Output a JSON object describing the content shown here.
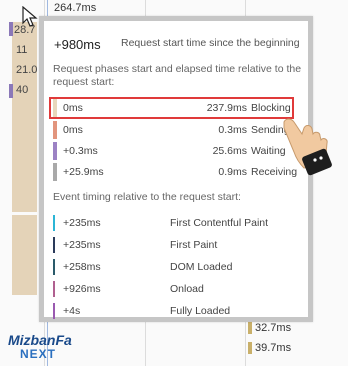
{
  "background": {
    "top_label": "264.7ms",
    "left_values": [
      "28.7",
      "11",
      "21.0",
      "40"
    ],
    "bottom_values": [
      "32.7ms",
      "39.7ms"
    ]
  },
  "popup": {
    "summary": {
      "value": "+980ms",
      "label": "Request start time since the beginning"
    },
    "phases_title": "Request phases start and elapsed time relative to the request start:",
    "phases": [
      {
        "start": "0ms",
        "elapsed": "237.9ms",
        "name": "Blocking",
        "color": "#e8d8bc"
      },
      {
        "start": "0ms",
        "elapsed": "0.3ms",
        "name": "Sending",
        "color": "#e2957d"
      },
      {
        "start": "+0.3ms",
        "elapsed": "25.6ms",
        "name": "Waiting",
        "color": "#9c82c4"
      },
      {
        "start": "+25.9ms",
        "elapsed": "0.9ms",
        "name": "Receiving",
        "color": "#a9a9a9"
      }
    ],
    "events_title": "Event timing relative to the request start:",
    "events": [
      {
        "time": "+235ms",
        "name": "First Contentful Paint",
        "color": "#2bb5d6"
      },
      {
        "time": "+235ms",
        "name": "First Paint",
        "color": "#2a3a5a"
      },
      {
        "time": "+258ms",
        "name": "DOM Loaded",
        "color": "#2a5a6a"
      },
      {
        "time": "+926ms",
        "name": "Onload",
        "color": "#b06090"
      },
      {
        "time": "+4s",
        "name": "Fully Loaded",
        "color": "#9a5ab0"
      }
    ]
  },
  "watermark": {
    "brand": "MizbanFa",
    "sub": "NEXT"
  }
}
